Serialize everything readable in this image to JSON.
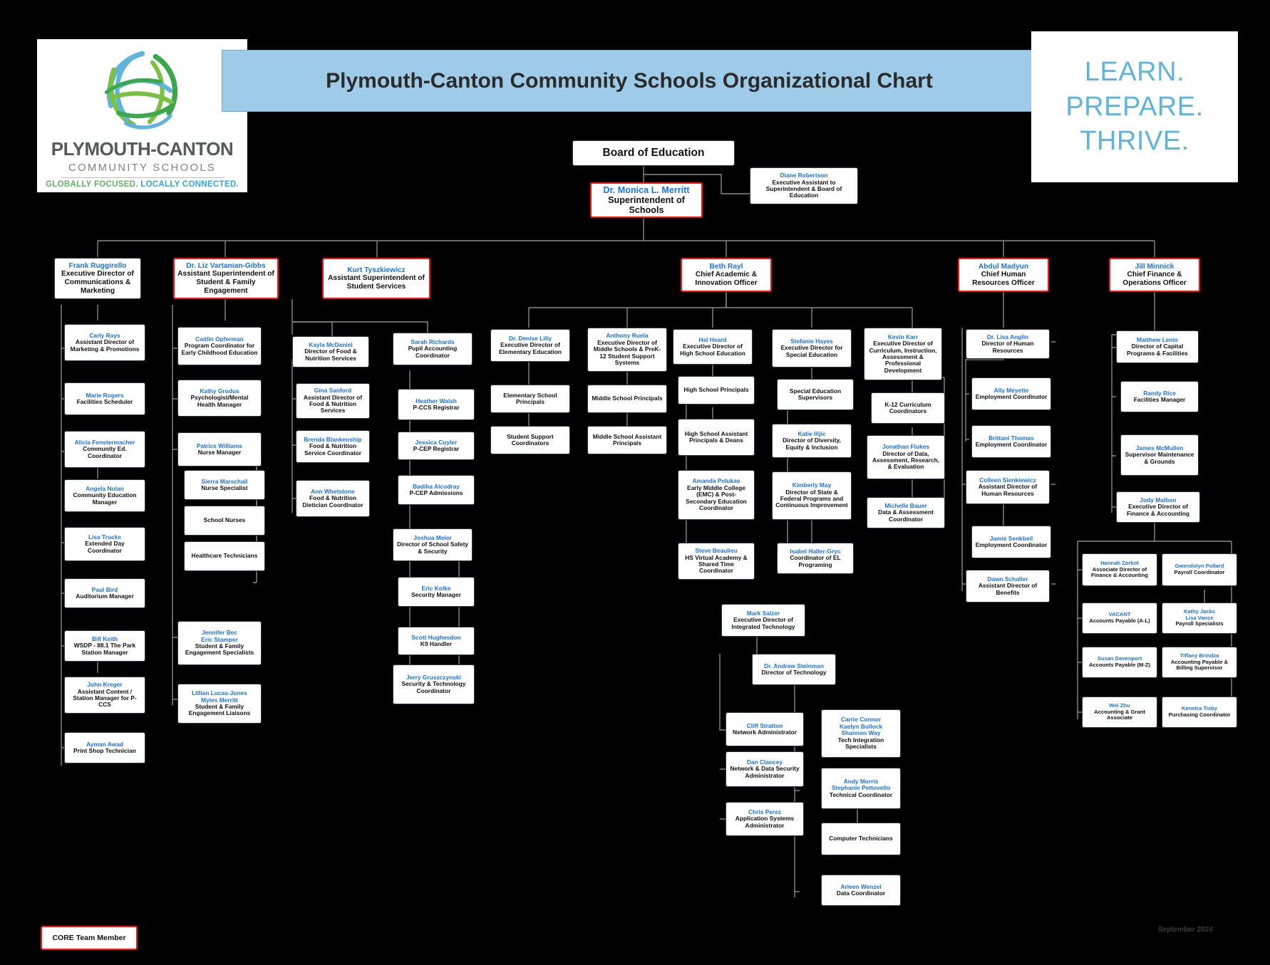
{
  "header": {
    "title": "Plymouth-Canton Community Schools Organizational Chart",
    "logo": {
      "name": "PLYMOUTH-CANTON",
      "subtitle": "COMMUNITY SCHOOLS",
      "tagline_green": "GLOBALLY FOCUSED.",
      "tagline_blue": "LOCALLY CONNECTED."
    },
    "tagline": [
      "LEARN.",
      "PREPARE.",
      "THRIVE."
    ]
  },
  "legend": {
    "label": "CORE Team Member"
  },
  "footer": {
    "date": "September 2024"
  },
  "colors": {
    "accent_blue": "#1a73e8",
    "core_red": "#ff1111",
    "title_band": "#9dcbe8",
    "tagline_blue": "#5fb4dd",
    "background": "#000000"
  },
  "nodes": [
    {
      "id": "board",
      "name": "",
      "title": "Board of Education",
      "core": false
    },
    {
      "id": "supt",
      "name": "Dr. Monica L. Merritt",
      "title": "Superintendent of Schools",
      "core": true
    },
    {
      "id": "ea",
      "name": "Diane Robertson",
      "title": "Executive Assistant to Superintendent & Board of Education",
      "core": false
    },
    {
      "id": "ruggirello",
      "name": "Frank Ruggirello",
      "title": "Executive Director of Communications & Marketing",
      "core": false
    },
    {
      "id": "vartanian",
      "name": "Dr. Liz Vartanian-Gibbs",
      "title": "Assistant Superintendent of Student & Family Engagement",
      "core": true
    },
    {
      "id": "tyszkiewicz",
      "name": "Kurt Tyszkiewicz",
      "title": "Assistant Superintendent of Student Services",
      "core": true
    },
    {
      "id": "rayl",
      "name": "Beth Rayl",
      "title": "Chief Academic & Innovation Officer",
      "core": true
    },
    {
      "id": "madyun",
      "name": "Abdul Madyun",
      "title": "Chief Human Resources Officer",
      "core": true
    },
    {
      "id": "minnick",
      "name": "Jill Minnick",
      "title": "Chief Finance & Operations Officer",
      "core": true
    },
    {
      "id": "rays",
      "name": "Carly Rays",
      "title": "Assistant Director of Marketing & Promotions",
      "core": false
    },
    {
      "id": "mrogers",
      "name": "Marie Rogers",
      "title": "Facilities Scheduler",
      "core": false
    },
    {
      "id": "fenstermacher",
      "name": "Alicia Fenstermacher",
      "title": "Community Ed. Coordinator",
      "core": false
    },
    {
      "id": "nolan",
      "name": "Angela Nolan",
      "title": "Community Education Manager",
      "core": false
    },
    {
      "id": "trucks",
      "name": "Lisa Trucks",
      "title": "Extended Day Coordinator",
      "core": false
    },
    {
      "id": "bird",
      "name": "Paul Bird",
      "title": "Auditorium Manager",
      "core": false
    },
    {
      "id": "keith",
      "name": "Bill Keith",
      "title": "WSDP - 88.1 The Park Station Manager",
      "core": false
    },
    {
      "id": "kreger",
      "name": "John Kreger",
      "title": "Assistant Content / Station Manager for P-CCS",
      "core": false
    },
    {
      "id": "awad",
      "name": "Ayman Awad",
      "title": "Print Shop Technician",
      "core": false
    },
    {
      "id": "opferman",
      "name": "Caitlin Opferman",
      "title": "Program Coordinator for Early Childhood Education",
      "core": false
    },
    {
      "id": "grodus",
      "name": "Kathy Grodus",
      "title": "Psychologist/Mental Health Manager",
      "core": false
    },
    {
      "id": "pwilliams",
      "name": "Patrice Williams",
      "title": "Nurse Manager",
      "core": false
    },
    {
      "id": "marschall",
      "name": "Sierra Marschall",
      "title": "Nurse Specialist",
      "core": false
    },
    {
      "id": "schoolnurses",
      "name": "",
      "title": "School Nurses",
      "core": false
    },
    {
      "id": "healthtech",
      "name": "",
      "title": "Healthcare Technicians",
      "core": false
    },
    {
      "id": "bec",
      "name": "Jennifer Bec\nEric Stamper",
      "title": "Student & Family Engagement Specialists",
      "core": false
    },
    {
      "id": "lucasjones",
      "name": "Lillian Lucas-Jones\nMyles Merritt",
      "title": "Student & Family Engagement Liaisons",
      "core": false
    },
    {
      "id": "mcdaniel",
      "name": "Kayla McDaniel",
      "title": "Director of Food & Nutrition Services",
      "core": false
    },
    {
      "id": "sanford",
      "name": "Gina Sanford",
      "title": "Assistant Director of Food & Nutrition Services",
      "core": false
    },
    {
      "id": "blankenship",
      "name": "Brenda Blankenship",
      "title": "Food & Nutrition Service Coordinator",
      "core": false
    },
    {
      "id": "whetstone",
      "name": "Ann Whetstone",
      "title": "Food & Nutrition Dietician Coordinator",
      "core": false
    },
    {
      "id": "srichards",
      "name": "Sarah Richards",
      "title": "Pupil Accounting Coordinator",
      "core": false
    },
    {
      "id": "hwalsh",
      "name": "Heather Walsh",
      "title": "P-CCS Registrar",
      "core": false
    },
    {
      "id": "cuyler",
      "name": "Jessica Cuyler",
      "title": "P-CEP Registrar",
      "core": false
    },
    {
      "id": "alcodray",
      "name": "Badiha Alcodray",
      "title": "P-CEP Admissions",
      "core": false
    },
    {
      "id": "meier",
      "name": "Joshua Meier",
      "title": "Director of School Safety & Security",
      "core": false
    },
    {
      "id": "kolke",
      "name": "Eric Kolke",
      "title": "Security Manager",
      "core": false
    },
    {
      "id": "hughesdon",
      "name": "Scott Hughesdon",
      "title": "K9 Handler",
      "core": false
    },
    {
      "id": "gruszczynski",
      "name": "Jerry Gruszczynski",
      "title": "Security & Technology Coordinator",
      "core": false
    },
    {
      "id": "lilly",
      "name": "Dr. Denise Lilly",
      "title": "Executive Director of Elementary Education",
      "core": false
    },
    {
      "id": "elemprinc",
      "name": "",
      "title": "Elementary School Principals",
      "core": false
    },
    {
      "id": "studsupco",
      "name": "",
      "title": "Student Support Coordinators",
      "core": false
    },
    {
      "id": "ruela",
      "name": "Anthony Ruela",
      "title": "Executive Director of Middle Schools & PreK-12 Student Support Systems",
      "core": false
    },
    {
      "id": "msprinc",
      "name": "",
      "title": "Middle School Principals",
      "core": false
    },
    {
      "id": "msassist",
      "name": "",
      "title": "Middle School Assistant Principals",
      "core": false
    },
    {
      "id": "heard",
      "name": "Hal Heard",
      "title": "Executive Director of High School Education",
      "core": false
    },
    {
      "id": "hsprinc",
      "name": "",
      "title": "High School Principals",
      "core": false
    },
    {
      "id": "hsassist",
      "name": "",
      "title": "High School Assistant Principals & Deans",
      "core": false
    },
    {
      "id": "pelukas",
      "name": "Amanda Pelukas",
      "title": "Early Middle College (EMC) & Post- Secondary Education Coordinator",
      "core": false
    },
    {
      "id": "beaulieu",
      "name": "Steve Beaulieu",
      "title": "HS Virtual Academy & Shared Time Coordinator",
      "core": false
    },
    {
      "id": "hayes",
      "name": "Stefanie Hayes",
      "title": "Executive Director for Special Education",
      "core": false
    },
    {
      "id": "spedsup",
      "name": "",
      "title": "Special Education Supervisors",
      "core": false
    },
    {
      "id": "ilijic",
      "name": "Katie Ilijic",
      "title": "Director of Diversity, Equity & Inclusion",
      "core": false
    },
    {
      "id": "kmay",
      "name": "Kimberly May",
      "title": "Director of State & Federal Programs and Continuous Improvement",
      "core": false
    },
    {
      "id": "hallergryc",
      "name": "Isabel Haller-Gryc",
      "title": "Coordinator of EL Programing",
      "core": false
    },
    {
      "id": "karr",
      "name": "Kevin Karr",
      "title": "Executive Director of Curriculum, Instruction, Assessment & Professional Development",
      "core": false
    },
    {
      "id": "k12curr",
      "name": "",
      "title": "K-12 Curriculum Coordinators",
      "core": false
    },
    {
      "id": "flukes",
      "name": "Jonathan Flukes",
      "title": "Director of Data, Assessment, Research, & Evaluation",
      "core": false
    },
    {
      "id": "mbauer",
      "name": "Michelle Bauer",
      "title": "Data & Assessment Coordinator",
      "core": false
    },
    {
      "id": "anglin",
      "name": "Dr. Lisa Anglin",
      "title": "Director of Human Resources",
      "core": false
    },
    {
      "id": "meyette",
      "name": "Ally Meyette",
      "title": "Employment Coordinator",
      "core": false
    },
    {
      "id": "bthomas",
      "name": "Brittani Thomas",
      "title": "Employment Coordinator",
      "core": false
    },
    {
      "id": "sienkiewicz",
      "name": "Colleen Sienkiewicz",
      "title": "Assistant Director of Human Resources",
      "core": false
    },
    {
      "id": "senkbeil",
      "name": "Jamie Senkbeil",
      "title": "Employment Coordinator",
      "core": false
    },
    {
      "id": "schaller",
      "name": "Dawn Schaller",
      "title": "Assistant Director of Benefits",
      "core": false
    },
    {
      "id": "lents",
      "name": "Matthew Lents",
      "title": "Director of Capital Programs & Facilities",
      "core": false
    },
    {
      "id": "rice",
      "name": "Randy Rice",
      "title": "Facilities Manager",
      "core": false
    },
    {
      "id": "mcmullen",
      "name": "James McMullen",
      "title": "Supervisor Maintenance & Grounds",
      "core": false
    },
    {
      "id": "malbon",
      "name": "Jody Malbon",
      "title": "Executive Director of Finance & Accounting",
      "core": false
    },
    {
      "id": "zorkot",
      "name": "Hannah Zorkot",
      "title": "Associate Director of Finance & Accounting",
      "core": false
    },
    {
      "id": "vacant",
      "name": "VACANT",
      "title": "Accounts Payable (A-L)",
      "core": false
    },
    {
      "id": "davenport",
      "name": "Susan Davenport",
      "title": "Accounts Payable (M-Z)",
      "core": false
    },
    {
      "id": "weizhu",
      "name": "Wei Zhu",
      "title": "Accounting & Grant Associate",
      "core": false
    },
    {
      "id": "pollard",
      "name": "Gwendolyn Pollard",
      "title": "Payroll Coordinator",
      "core": false
    },
    {
      "id": "jacks",
      "name": "Kathy Jacks\nLisa Vance",
      "title": "Payroll Specialists",
      "core": false
    },
    {
      "id": "brindza",
      "name": "Tiffany Brindza",
      "title": "Accounting Payable & Billing Supervisor",
      "core": false
    },
    {
      "id": "tisby",
      "name": "Kenetra Tisby",
      "title": "Purchasing Coordinator",
      "core": false
    },
    {
      "id": "salzer",
      "name": "Mark Salzer",
      "title": "Executive Director of Integrated Technology",
      "core": false
    },
    {
      "id": "steinman",
      "name": "Dr. Andrew Steinman",
      "title": "Director of Technology",
      "core": false
    },
    {
      "id": "stratton",
      "name": "Cliff Stratton",
      "title": "Network Administrator",
      "core": false
    },
    {
      "id": "clancey",
      "name": "Dan Clancey",
      "title": "Network & Data Security Administrator",
      "core": false
    },
    {
      "id": "cperez",
      "name": "Chris Perez",
      "title": "Application Systems Administrator",
      "core": false
    },
    {
      "id": "connor",
      "name": "Carrie Connor\nKaelyn Bullock\nShannon Way",
      "title": "Tech Integration Specialists",
      "core": false
    },
    {
      "id": "amorris",
      "name": "Andy Morris\nStephanie Pettovello",
      "title": "Technical Coordinator",
      "core": false
    },
    {
      "id": "comptech",
      "name": "",
      "title": "Computer Technicians",
      "core": false
    },
    {
      "id": "wenzel",
      "name": "Arleen Wenzel",
      "title": "Data Coordinator",
      "core": false
    }
  ]
}
